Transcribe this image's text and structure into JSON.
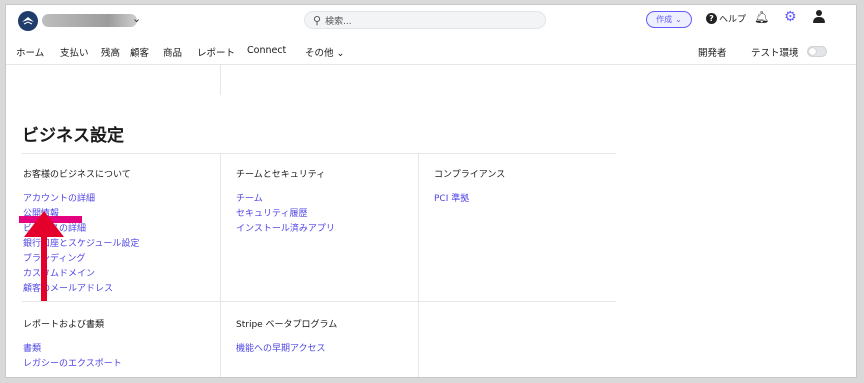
{
  "header": {
    "search_placeholder": "検索...",
    "create_label": "作成",
    "help_label": "ヘルプ"
  },
  "nav": {
    "items": [
      "ホーム",
      "支払い",
      "残高",
      "顧客",
      "商品",
      "レポート",
      "Connect",
      "その他"
    ],
    "developers": "開発者",
    "test_mode": "テスト環境"
  },
  "page": {
    "title": "ビジネス設定"
  },
  "sections": [
    {
      "title": "お客様のビジネスについて",
      "links": [
        "アカウントの詳細",
        "公開情報",
        "ビジネスの詳細",
        "銀行口座とスケジュール設定",
        "ブランディング",
        "カスタムドメイン",
        "顧客のメールアドレス"
      ]
    },
    {
      "title": "チームとセキュリティ",
      "links": [
        "チーム",
        "セキュリティ履歴",
        "インストール済みアプリ"
      ]
    },
    {
      "title": "コンプライアンス",
      "links": [
        "PCI 準拠"
      ]
    },
    {
      "title": "レポートおよび書類",
      "links": [
        "書類",
        "レガシーのエクスポート"
      ]
    },
    {
      "title": "Stripe ベータプログラム",
      "links": [
        "機能への早期アクセス"
      ]
    }
  ],
  "colors": {
    "accent": "#635bff",
    "link": "#4f46e5",
    "annotation": "#e4002b"
  }
}
